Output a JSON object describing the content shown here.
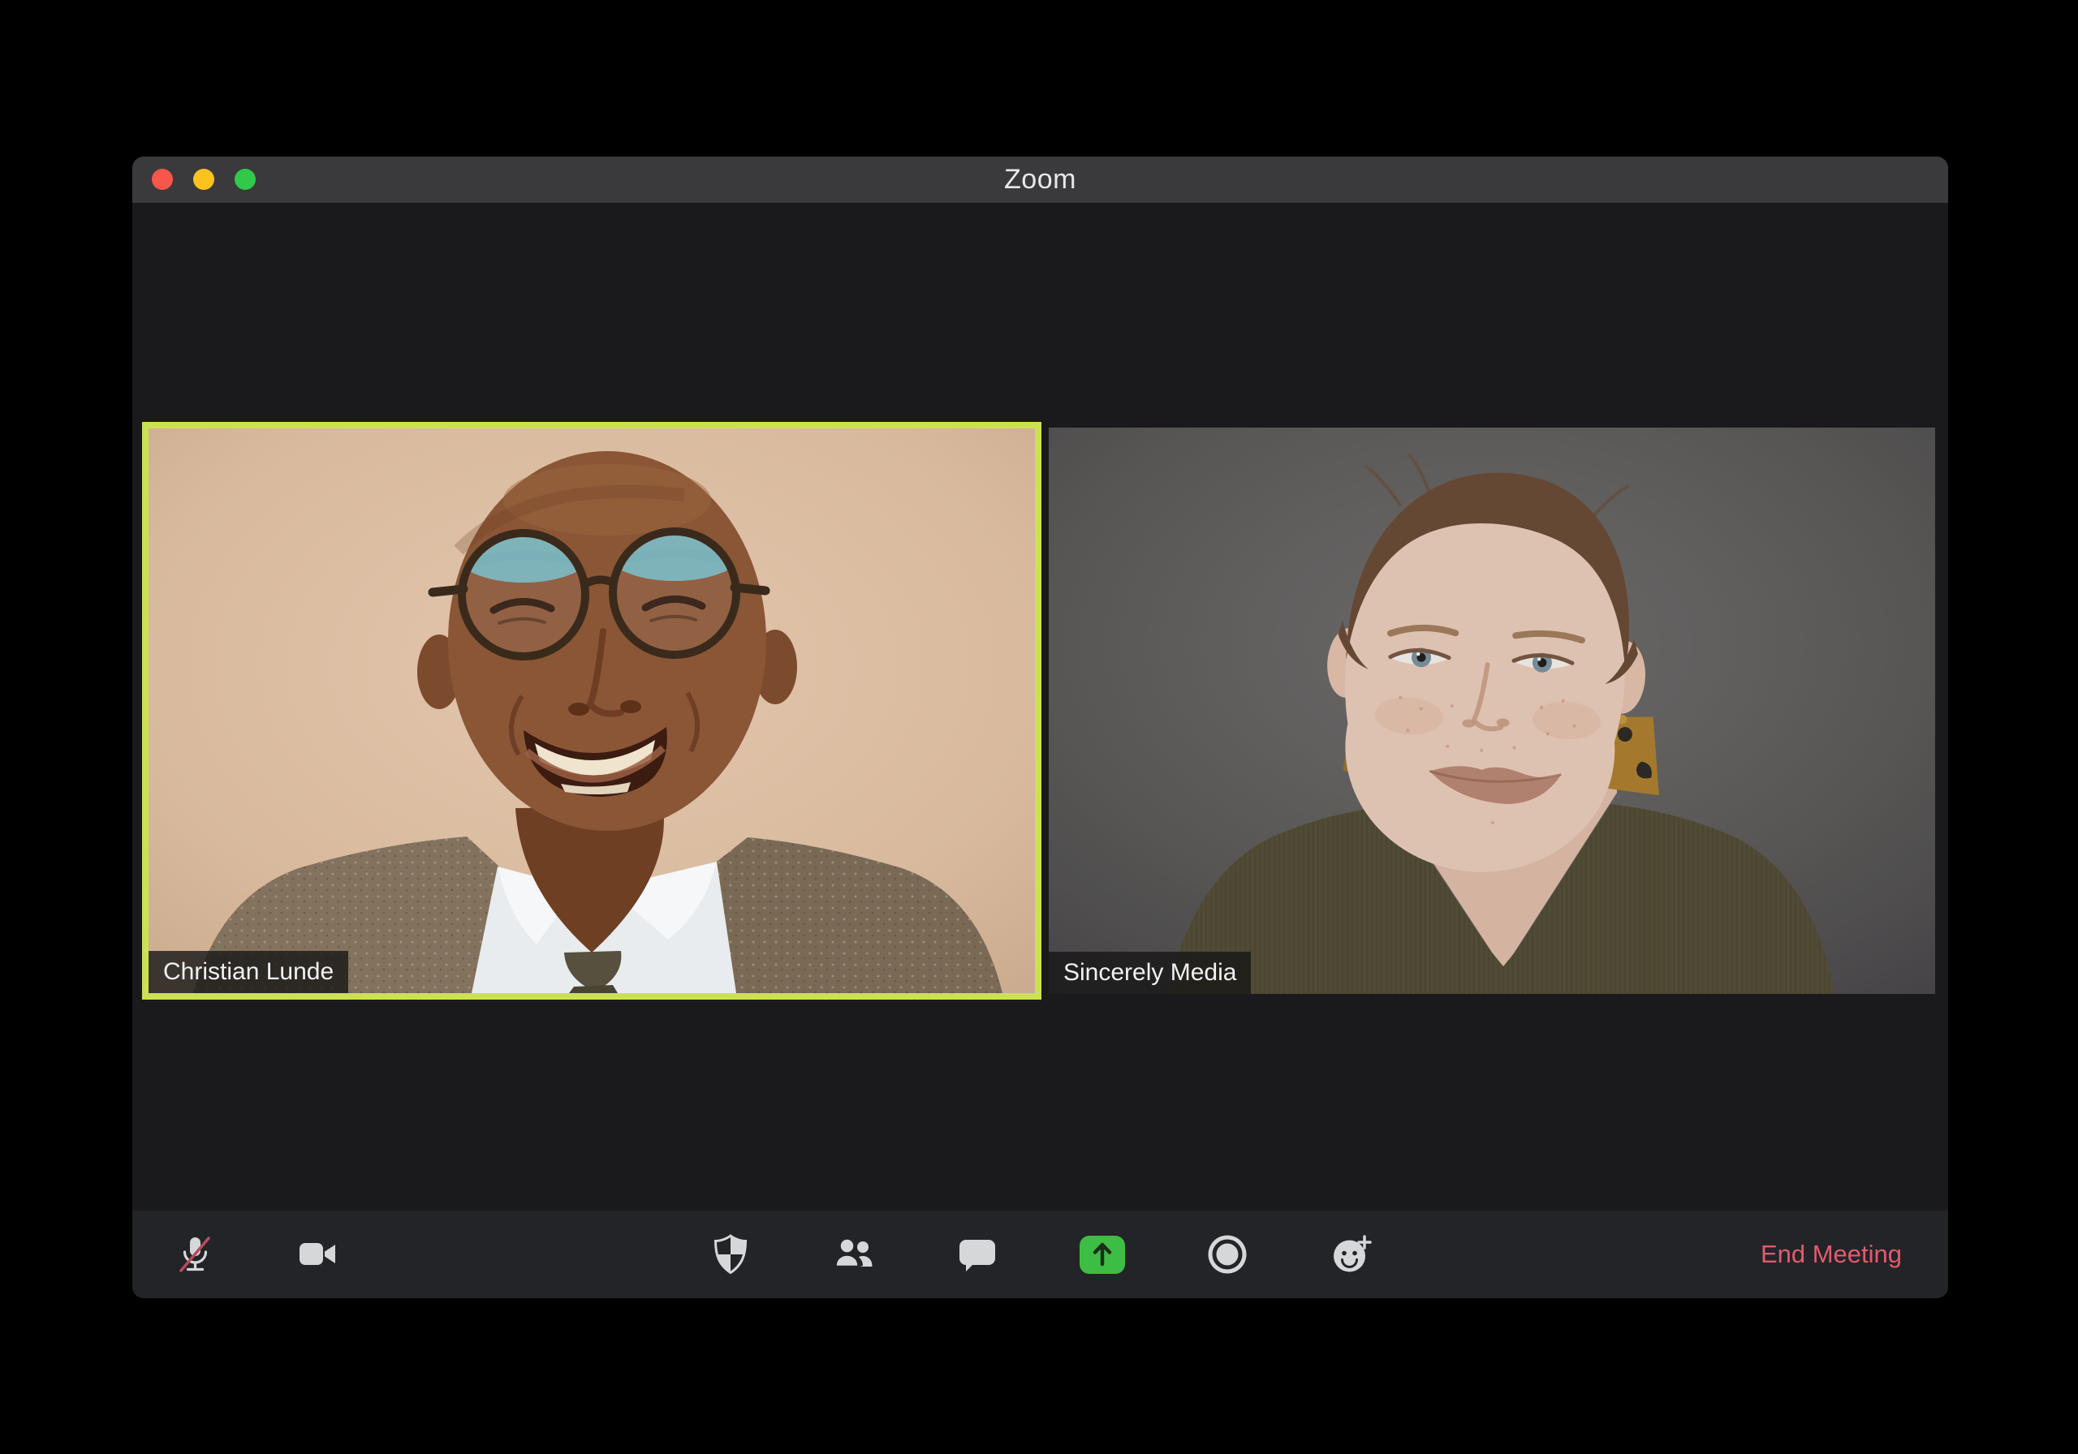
{
  "window": {
    "title": "Zoom",
    "traffic_lights": [
      {
        "name": "close",
        "color": "#f7564b"
      },
      {
        "name": "minimize",
        "color": "#fcc21d"
      },
      {
        "name": "fullscreen",
        "color": "#30c948"
      }
    ]
  },
  "participants": [
    {
      "name": "Christian Lunde",
      "active_speaker": true
    },
    {
      "name": "Sincerely Media",
      "active_speaker": false
    }
  ],
  "toolbar": {
    "buttons": [
      {
        "name": "mute",
        "icon": "microphone-muted-icon",
        "state": "muted"
      },
      {
        "name": "video",
        "icon": "video-camera-icon",
        "state": "on"
      },
      {
        "name": "security",
        "icon": "shield-icon"
      },
      {
        "name": "participants",
        "icon": "participants-icon"
      },
      {
        "name": "chat",
        "icon": "chat-bubble-icon"
      },
      {
        "name": "share-screen",
        "icon": "share-screen-arrow-icon"
      },
      {
        "name": "record",
        "icon": "record-icon"
      },
      {
        "name": "reactions",
        "icon": "reactions-smiley-icon"
      }
    ],
    "end_meeting_label": "End Meeting"
  },
  "colors": {
    "active_speaker_border": "#cbe153",
    "share_button_green": "#3ebd44",
    "end_meeting_red": "#e45a6e",
    "titlebar_bg": "#3a3a3c",
    "window_bg": "#1a1a1c",
    "toolbar_bg": "#232427",
    "icon_gray": "#d6d7d9",
    "mute_slash_red": "#b34b5e"
  }
}
